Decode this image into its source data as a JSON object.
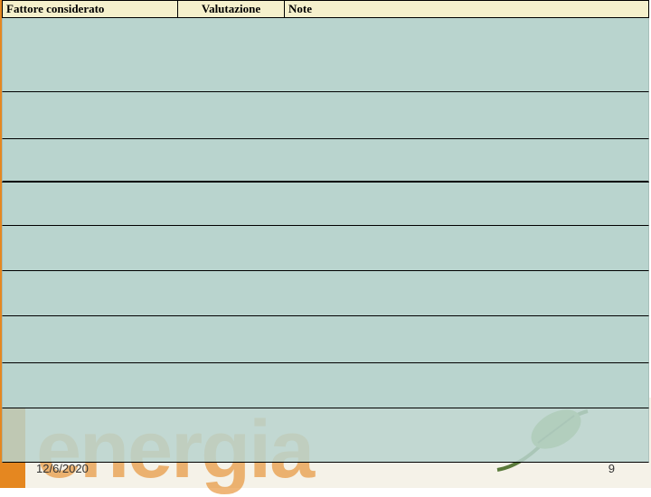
{
  "table": {
    "headers": {
      "col1": "Fattore considerato",
      "col2": "Valutazione",
      "col3": "Note"
    },
    "rows": [
      {
        "col1": "",
        "col2": "",
        "col3": ""
      },
      {
        "col1": "",
        "col2": "",
        "col3": ""
      },
      {
        "col1": "",
        "col2": "",
        "col3": ""
      },
      {
        "col1": "",
        "col2": "",
        "col3": ""
      },
      {
        "col1": "",
        "col2": "",
        "col3": ""
      },
      {
        "col1": "",
        "col2": "",
        "col3": ""
      },
      {
        "col1": "",
        "col2": "",
        "col3": ""
      },
      {
        "col1": "",
        "col2": "",
        "col3": ""
      },
      {
        "col1": "",
        "col2": "",
        "col3": ""
      }
    ]
  },
  "footer": {
    "date": "12/6/2020",
    "page": "9"
  },
  "background": {
    "watermark": "energia"
  }
}
